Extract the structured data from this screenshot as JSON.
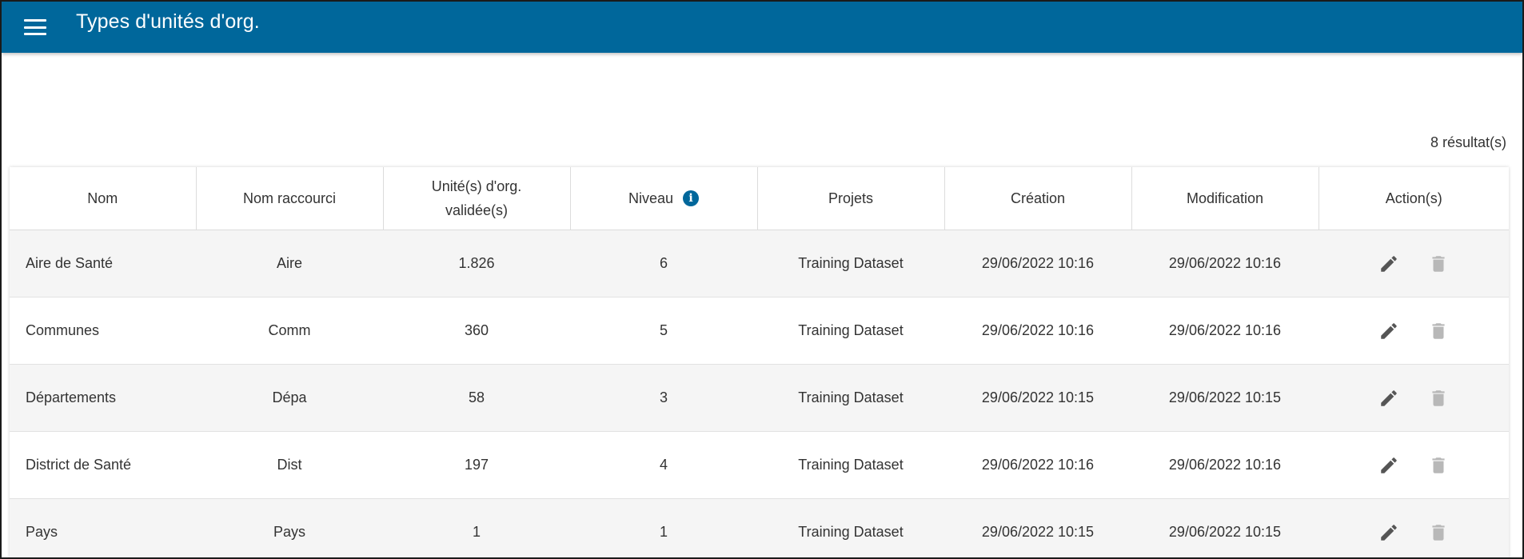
{
  "appbar": {
    "title": "Types d'unités d'org.",
    "color": "#00679b",
    "menu_icon": "menu-icon"
  },
  "results_count": "8 résultat(s)",
  "table": {
    "columns": [
      "Nom",
      "Nom raccourci",
      "Unité(s) d'org.",
      "validée(s)",
      "Niveau",
      "Projets",
      "Création",
      "Modification",
      "Action(s)"
    ],
    "rows": [
      {
        "nom": "Aire de Santé",
        "short": "Aire",
        "units": "1.826",
        "level": "6",
        "projects": "Training Dataset",
        "created": "29/06/2022 10:16",
        "updated": "29/06/2022 10:16"
      },
      {
        "nom": "Communes",
        "short": "Comm",
        "units": "360",
        "level": "5",
        "projects": "Training Dataset",
        "created": "29/06/2022 10:16",
        "updated": "29/06/2022 10:16"
      },
      {
        "nom": "Départements",
        "short": "Dépa",
        "units": "58",
        "level": "3",
        "projects": "Training Dataset",
        "created": "29/06/2022 10:15",
        "updated": "29/06/2022 10:15"
      },
      {
        "nom": "District de Santé",
        "short": "Dist",
        "units": "197",
        "level": "4",
        "projects": "Training Dataset",
        "created": "29/06/2022 10:16",
        "updated": "29/06/2022 10:16"
      },
      {
        "nom": "Pays",
        "short": "Pays",
        "units": "1",
        "level": "1",
        "projects": "Training Dataset",
        "created": "29/06/2022 10:15",
        "updated": "29/06/2022 10:15"
      }
    ],
    "row_actions": [
      "edit-icon",
      "delete-icon"
    ]
  }
}
